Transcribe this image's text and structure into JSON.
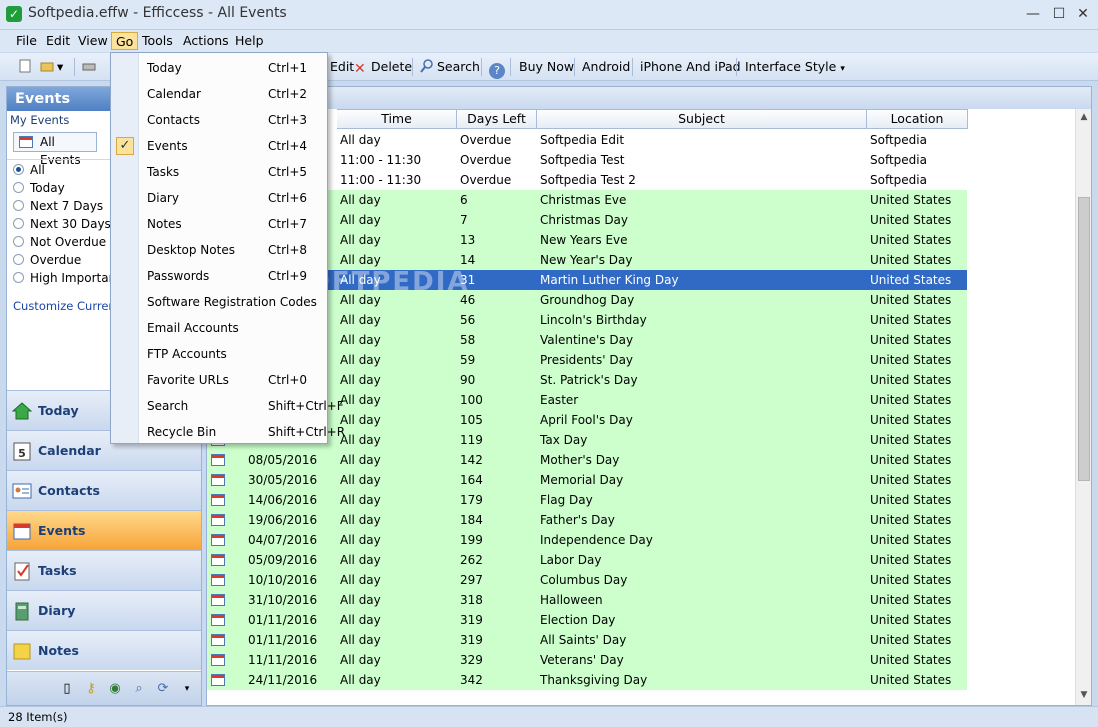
{
  "window": {
    "title": "Softpedia.effw - Efficcess - All Events",
    "minimize": "—",
    "maximize": "☐",
    "close": "✕"
  },
  "menubar": {
    "items": [
      "File",
      "Edit",
      "View",
      "Go",
      "Tools",
      "Actions",
      "Help"
    ],
    "active": "Go"
  },
  "toolbar": {
    "edit": "Edit",
    "delete": "Delete",
    "search": "Search",
    "buy_now": "Buy Now",
    "android": "Android",
    "iphone": "iPhone And iPad",
    "interface_style": "Interface Style"
  },
  "left_panel": {
    "header": "Events",
    "my_events": "My Events",
    "chip": "All Events",
    "filters": [
      {
        "label": "All",
        "selected": true
      },
      {
        "label": "Today",
        "selected": false
      },
      {
        "label": "Next 7 Days",
        "selected": false
      },
      {
        "label": "Next 30 Days",
        "selected": false
      },
      {
        "label": "Not Overdue",
        "selected": false
      },
      {
        "label": "Overdue",
        "selected": false
      },
      {
        "label": "High Importan",
        "selected": false
      }
    ],
    "customize_link": "Customize Current V",
    "nav": [
      {
        "label": "Today",
        "icon": "home-icon"
      },
      {
        "label": "Calendar",
        "icon": "calendar-icon"
      },
      {
        "label": "Contacts",
        "icon": "contacts-icon"
      },
      {
        "label": "Events",
        "icon": "events-icon",
        "active": true
      },
      {
        "label": "Tasks",
        "icon": "tasks-icon"
      },
      {
        "label": "Diary",
        "icon": "diary-icon"
      },
      {
        "label": "Notes",
        "icon": "notes-icon"
      }
    ]
  },
  "go_menu": {
    "items": [
      {
        "label": "Today",
        "shortcut": "Ctrl+1"
      },
      {
        "label": "Calendar",
        "shortcut": "Ctrl+2"
      },
      {
        "label": "Contacts",
        "shortcut": "Ctrl+3"
      },
      {
        "label": "Events",
        "shortcut": "Ctrl+4",
        "checked": true
      },
      {
        "label": "Tasks",
        "shortcut": "Ctrl+5"
      },
      {
        "label": "Diary",
        "shortcut": "Ctrl+6"
      },
      {
        "label": "Notes",
        "shortcut": "Ctrl+7"
      },
      {
        "label": "Desktop Notes",
        "shortcut": "Ctrl+8"
      },
      {
        "label": "Passwords",
        "shortcut": "Ctrl+9"
      },
      {
        "label": "Software Registration Codes",
        "shortcut": ""
      },
      {
        "label": "Email Accounts",
        "shortcut": ""
      },
      {
        "label": "FTP Accounts",
        "shortcut": ""
      },
      {
        "label": "Favorite URLs",
        "shortcut": "Ctrl+0"
      },
      {
        "label": "Search",
        "shortcut": "Shift+Ctrl+F"
      },
      {
        "label": "Recycle Bin",
        "shortcut": "Shift+Ctrl+R"
      }
    ]
  },
  "table": {
    "columns": [
      "Time",
      "Days Left",
      "Subject",
      "Location"
    ],
    "watermark": "SOFTPEDIA",
    "rows": [
      {
        "date": "",
        "time": "All day",
        "days": "Overdue",
        "subject": "Softpedia Edit",
        "location": "Softpedia",
        "style": "white"
      },
      {
        "date": "",
        "time": "11:00 - 11:30",
        "days": "Overdue",
        "subject": "Softpedia Test",
        "location": "Softpedia",
        "style": "white"
      },
      {
        "date": "",
        "time": "11:00 - 11:30",
        "days": "Overdue",
        "subject": "Softpedia Test 2",
        "location": "Softpedia",
        "style": "white"
      },
      {
        "date": "",
        "time": "All day",
        "days": "6",
        "subject": "Christmas Eve",
        "location": "United States",
        "style": "green"
      },
      {
        "date": "",
        "time": "All day",
        "days": "7",
        "subject": "Christmas Day",
        "location": "United States",
        "style": "green"
      },
      {
        "date": "",
        "time": "All day",
        "days": "13",
        "subject": "New Years Eve",
        "location": "United States",
        "style": "green"
      },
      {
        "date": "",
        "time": "All day",
        "days": "14",
        "subject": "New Year's Day",
        "location": "United States",
        "style": "green"
      },
      {
        "date": "",
        "time": "All day",
        "days": "31",
        "subject": "Martin Luther King Day",
        "location": "United States",
        "style": "selected"
      },
      {
        "date": "",
        "time": "All day",
        "days": "46",
        "subject": "Groundhog Day",
        "location": "United States",
        "style": "green"
      },
      {
        "date": "",
        "time": "All day",
        "days": "56",
        "subject": "Lincoln's Birthday",
        "location": "United States",
        "style": "green"
      },
      {
        "date": "",
        "time": "All day",
        "days": "58",
        "subject": "Valentine's Day",
        "location": "United States",
        "style": "green"
      },
      {
        "date": "",
        "time": "All day",
        "days": "59",
        "subject": "Presidents' Day",
        "location": "United States",
        "style": "green"
      },
      {
        "date": "",
        "time": "All day",
        "days": "90",
        "subject": "St. Patrick's Day",
        "location": "United States",
        "style": "green"
      },
      {
        "date": "",
        "time": "All day",
        "days": "100",
        "subject": "Easter",
        "location": "United States",
        "style": "green"
      },
      {
        "date": "",
        "time": "All day",
        "days": "105",
        "subject": "April Fool's Day",
        "location": "United States",
        "style": "green"
      },
      {
        "date": "",
        "time": "All day",
        "days": "119",
        "subject": "Tax Day",
        "location": "United States",
        "style": "green"
      },
      {
        "date": "08/05/2016",
        "time": "All day",
        "days": "142",
        "subject": "Mother's Day",
        "location": "United States",
        "style": "green"
      },
      {
        "date": "30/05/2016",
        "time": "All day",
        "days": "164",
        "subject": "Memorial Day",
        "location": "United States",
        "style": "green"
      },
      {
        "date": "14/06/2016",
        "time": "All day",
        "days": "179",
        "subject": "Flag Day",
        "location": "United States",
        "style": "green"
      },
      {
        "date": "19/06/2016",
        "time": "All day",
        "days": "184",
        "subject": "Father's Day",
        "location": "United States",
        "style": "green"
      },
      {
        "date": "04/07/2016",
        "time": "All day",
        "days": "199",
        "subject": "Independence Day",
        "location": "United States",
        "style": "green"
      },
      {
        "date": "05/09/2016",
        "time": "All day",
        "days": "262",
        "subject": "Labor Day",
        "location": "United States",
        "style": "green"
      },
      {
        "date": "10/10/2016",
        "time": "All day",
        "days": "297",
        "subject": "Columbus Day",
        "location": "United States",
        "style": "green"
      },
      {
        "date": "31/10/2016",
        "time": "All day",
        "days": "318",
        "subject": "Halloween",
        "location": "United States",
        "style": "green"
      },
      {
        "date": "01/11/2016",
        "time": "All day",
        "days": "319",
        "subject": "Election Day",
        "location": "United States",
        "style": "green"
      },
      {
        "date": "01/11/2016",
        "time": "All day",
        "days": "319",
        "subject": "All Saints' Day",
        "location": "United States",
        "style": "green"
      },
      {
        "date": "11/11/2016",
        "time": "All day",
        "days": "329",
        "subject": "Veterans' Day",
        "location": "United States",
        "style": "green"
      },
      {
        "date": "24/11/2016",
        "time": "All day",
        "days": "342",
        "subject": "Thanksgiving Day",
        "location": "United States",
        "style": "green"
      }
    ]
  },
  "status": {
    "text": "28 Item(s)"
  },
  "colors": {
    "row_green": "#ccffcc",
    "row_selected": "#316ac5",
    "nav_active": "#f7a339",
    "panel_header": "#4f80c3"
  }
}
